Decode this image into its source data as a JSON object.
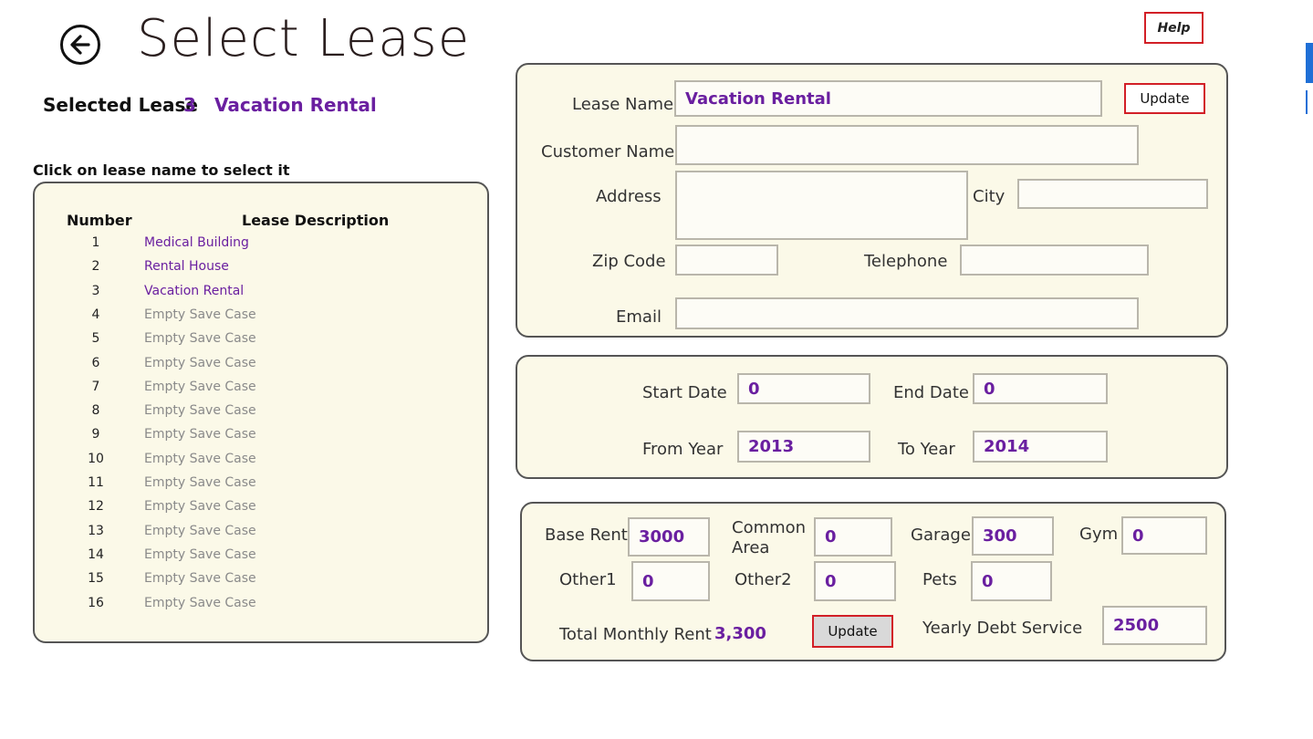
{
  "header": {
    "title": "Select Lease",
    "help_label": "Help"
  },
  "selected": {
    "label": "Selected Lease",
    "number": "3",
    "name": "Vacation Rental"
  },
  "instruction": "Click on lease name to select it",
  "lease_table": {
    "columns": [
      "Number",
      "Lease Description"
    ],
    "rows": [
      {
        "num": "1",
        "desc": "Medical Building"
      },
      {
        "num": "2",
        "desc": "Rental House"
      },
      {
        "num": "3",
        "desc": "Vacation Rental"
      },
      {
        "num": "4",
        "desc": "Empty Save Case"
      },
      {
        "num": "5",
        "desc": "Empty Save Case"
      },
      {
        "num": "6",
        "desc": "Empty Save Case"
      },
      {
        "num": "7",
        "desc": "Empty Save Case"
      },
      {
        "num": "8",
        "desc": "Empty Save Case"
      },
      {
        "num": "9",
        "desc": "Empty Save Case"
      },
      {
        "num": "10",
        "desc": "Empty Save Case"
      },
      {
        "num": "11",
        "desc": "Empty Save Case"
      },
      {
        "num": "12",
        "desc": "Empty Save Case"
      },
      {
        "num": "13",
        "desc": "Empty Save Case"
      },
      {
        "num": "14",
        "desc": "Empty Save Case"
      },
      {
        "num": "15",
        "desc": "Empty Save Case"
      },
      {
        "num": "16",
        "desc": "Empty Save Case"
      }
    ]
  },
  "lease_info": {
    "lease_name_label": "Lease Name",
    "lease_name_value": "Vacation Rental",
    "update_label": "Update",
    "customer_name_label": "Customer Name",
    "customer_name_value": "",
    "address_label": "Address",
    "address_value": "",
    "city_label": "City",
    "city_value": "",
    "zip_label": "Zip Code",
    "zip_value": "",
    "telephone_label": "Telephone",
    "telephone_value": "",
    "email_label": "Email",
    "email_value": ""
  },
  "dates": {
    "start_date_label": "Start Date",
    "start_date_value": "0",
    "end_date_label": "End Date",
    "end_date_value": "0",
    "from_year_label": "From Year",
    "from_year_value": "2013",
    "to_year_label": "To Year",
    "to_year_value": "2014"
  },
  "rent": {
    "base_rent_label": "Base Rent",
    "base_rent_value": "3000",
    "common_area_label_1": "Common",
    "common_area_label_2": "Area",
    "common_area_value": "0",
    "garage_label": "Garage",
    "garage_value": "300",
    "gym_label": "Gym",
    "gym_value": "0",
    "other1_label": "Other1",
    "other1_value": "0",
    "other2_label": "Other2",
    "other2_value": "0",
    "pets_label": "Pets",
    "pets_value": "0",
    "total_label": "Total Monthly Rent",
    "total_value": "3,300",
    "update_label": "Update",
    "debt_label": "Yearly Debt Service",
    "debt_value": "2500"
  },
  "colors": {
    "accent": "#6a1fa0",
    "panel_bg": "#fbf9e8",
    "button_border": "#d21f26",
    "empty_text": "#8a8a8a",
    "scroll_accent": "#1f6fd6"
  },
  "icons": {
    "back": "back-arrow-icon"
  }
}
